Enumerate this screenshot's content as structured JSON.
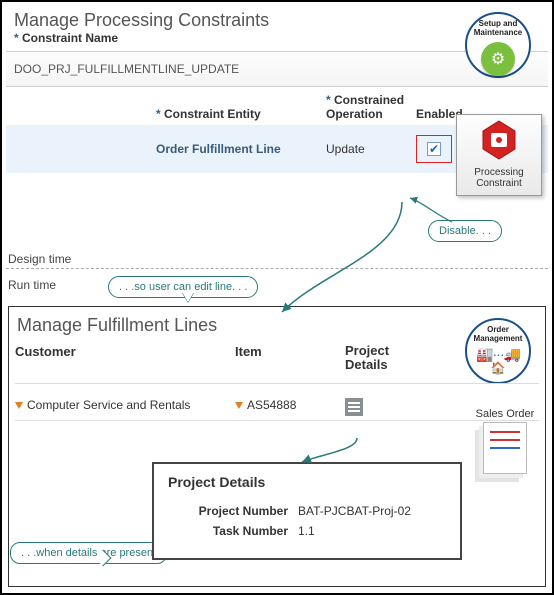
{
  "top": {
    "title": "Manage Processing Constraints",
    "name_label": "Constraint Name",
    "name_value": "DOO_PRJ_FULFILLMENTLINE_UPDATE",
    "columns": {
      "entity": "Constraint Entity",
      "operation": "Constrained Operation",
      "enabled": "Enabled"
    },
    "row": {
      "entity": "Order Fulfillment Line",
      "operation": "Update",
      "enabled": true
    }
  },
  "badges": {
    "setup": "Setup and Maintenance",
    "processing": "Processing Constraint",
    "order": "Order Management",
    "sales": "Sales Order"
  },
  "phases": {
    "design": "Design time",
    "run": "Run time"
  },
  "notes": {
    "disable": "Disable. . .",
    "edit": ". . .so user can edit line. . .",
    "details": ". . .when details are present"
  },
  "bottom": {
    "title": "Manage Fulfillment Lines",
    "columns": {
      "customer": "Customer",
      "item": "Item",
      "details": "Project Details"
    },
    "row": {
      "customer": "Computer Service and Rentals",
      "item": "AS54888"
    }
  },
  "popover": {
    "title": "Project Details",
    "project_label": "Project Number",
    "project_value": "BAT-PJCBAT-Proj-02",
    "task_label": "Task Number",
    "task_value": "1.1"
  }
}
